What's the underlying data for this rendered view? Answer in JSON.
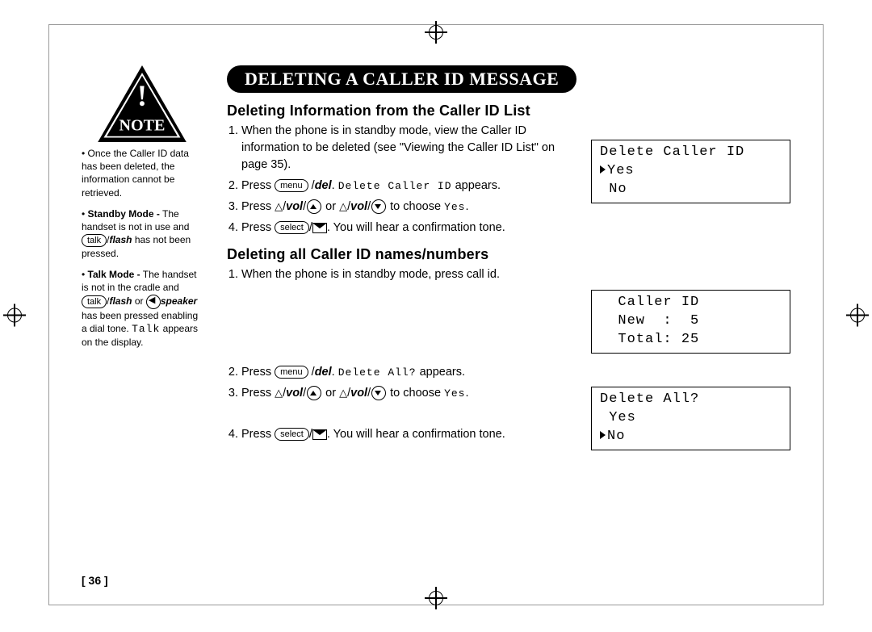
{
  "banner": "DELETING A CALLER ID MESSAGE",
  "note": {
    "label": "NOTE",
    "bullet1": "Once the Caller ID data has been deleted, the information cannot be retrieved.",
    "standby_label": "Standby Mode -",
    "standby_text_a": "The handset is not in use and",
    "standby_btn": "talk",
    "standby_flash": "flash",
    "standby_text_b": "has not been pressed.",
    "talk_label": "Talk Mode -",
    "talk_text_a": "The handset is not in the cradle and",
    "talk_btn": "talk",
    "talk_flash": "flash",
    "talk_or": "or",
    "talk_speaker": "speaker",
    "talk_text_b": "has been pressed enabling a dial tone.",
    "talk_lcd": "Talk",
    "talk_text_c": "appears on the display."
  },
  "section1": {
    "heading": "Deleting Information from the Caller ID List",
    "s1": "When the phone is in standby mode, view the Caller ID information to be deleted (see \"Viewing the Caller ID List\" on page 35).",
    "s2a": "Press",
    "s2btn": "menu",
    "s2del": "del",
    "s2dot": ".",
    "s2lcd": "Delete Caller ID",
    "s2b": "appears.",
    "s3a": "Press",
    "s3vol": "vol",
    "s3or": "or",
    "s3b": "to choose",
    "s3lcd": "Yes",
    "s3dot": ".",
    "s4a": "Press",
    "s4btn": "select",
    "s4b": ". You will hear a confirmation tone."
  },
  "section2": {
    "heading": "Deleting all Caller ID names/numbers",
    "s1": "When the phone is in standby mode, press call id.",
    "s2a": "Press",
    "s2btn": "menu",
    "s2del": "del",
    "s2dot": ".",
    "s2lcd": "Delete All?",
    "s2b": "appears.",
    "s3a": "Press",
    "s3vol": "vol",
    "s3or": "or",
    "s3b": "to choose",
    "s3lcd": "Yes",
    "s3dot": ".",
    "s4a": "Press",
    "s4btn": "select",
    "s4b": ". You will hear a confirmation tone."
  },
  "lcd1": {
    "l1": "Delete Caller ID",
    "l2": "Yes",
    "l3": "No"
  },
  "lcd2": {
    "l1": "Caller ID",
    "l2": "New  :  5",
    "l3": "Total: 25"
  },
  "lcd3": {
    "l1": "Delete All?",
    "l2": "Yes",
    "l3": "No"
  },
  "pagenum": "[ 36 ]"
}
